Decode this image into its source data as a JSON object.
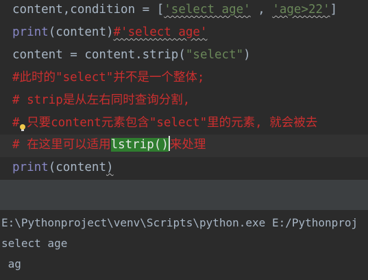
{
  "editor": {
    "lines": [
      {
        "parts": [
          "content,condition = [",
          "'select age'",
          " , ",
          "'age>22'",
          "]"
        ]
      },
      {
        "parts": [
          "print",
          "(content)",
          "#'select age'"
        ]
      },
      {
        "parts": [
          "content = content.strip(",
          "\"select\"",
          ")"
        ]
      },
      {
        "text": "#此时的\"select\"并不是一个整体;"
      },
      {
        "text": "# strip是从左右同时查询分割,"
      },
      {
        "parts": [
          "#",
          " 只要content元素包含\"select\"里的元素, 就会被去"
        ]
      },
      {
        "parts": [
          "# 在这里可以适用",
          "lstrip()",
          "来处理"
        ]
      },
      {
        "parts": [
          "print",
          "(content",
          ")"
        ]
      }
    ]
  },
  "console": {
    "lines": [
      "E:\\Pythonproject\\venv\\Scripts\\python.exe E:/Pythonproj",
      "select age",
      " ag"
    ]
  },
  "icons": {
    "intention": "lightbulb-icon"
  },
  "colors": {
    "keyword": "#8888c6",
    "string": "#6a8759",
    "comment": "#cc2f2f",
    "text": "#a9b7c6",
    "selection": "#2f7d2f",
    "background": "#2b2b2b"
  }
}
